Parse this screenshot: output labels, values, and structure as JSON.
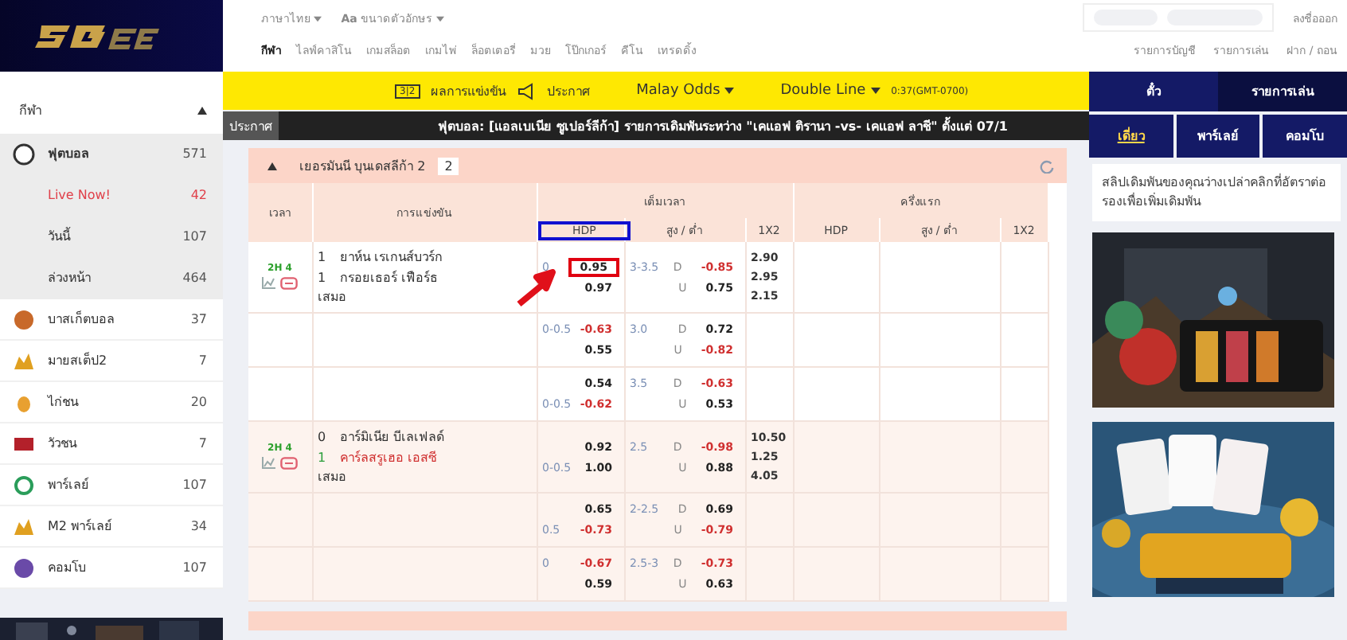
{
  "header": {
    "language": "ภาษาไทย",
    "font_size_icon": "Aa",
    "font_size": "ขนาดตัวอักษร",
    "logout": "ลงชื่อออก",
    "nav": [
      {
        "label": "กีฬา",
        "selected": true
      },
      {
        "label": "ไลฟ์คาสิโน",
        "selected": false
      },
      {
        "label": "เกมสล็อต",
        "selected": false
      },
      {
        "label": "เกมไพ่",
        "selected": false
      },
      {
        "label": "ล็อตเตอรี่",
        "selected": false
      },
      {
        "label": "มวย",
        "selected": false
      },
      {
        "label": "โป๊กเกอร์",
        "selected": false
      },
      {
        "label": "คีโน",
        "selected": false
      },
      {
        "label": "เทรดดิ้ง",
        "selected": false
      }
    ],
    "account_links": [
      "รายการบัญชี",
      "รายการเล่น",
      "ฝาก / ถอน"
    ]
  },
  "sidebar": {
    "title": "กีฬา",
    "items": [
      {
        "kind": "soccer",
        "label": "ฟุตบอล",
        "count": "571",
        "expanded": true,
        "children": [
          {
            "label": "Live Now!",
            "count": "42",
            "live": true
          },
          {
            "label": "วันนี้",
            "count": "107",
            "live": false
          },
          {
            "label": "ล่วงหน้า",
            "count": "464",
            "live": false
          }
        ]
      },
      {
        "kind": "basketball",
        "label": "บาสเก็ตบอล",
        "count": "37",
        "expanded": false
      },
      {
        "kind": "mixparlay",
        "label": "มายสเต็ป2",
        "count": "7",
        "expanded": false
      },
      {
        "kind": "cockfight",
        "label": "ไก่ชน",
        "count": "20",
        "expanded": false
      },
      {
        "kind": "bullfight",
        "label": "วัวชน",
        "count": "7",
        "expanded": false
      },
      {
        "kind": "parlay",
        "label": "พาร์เลย์",
        "count": "107",
        "expanded": false
      },
      {
        "kind": "mixparlay",
        "label": "M2 พาร์เลย์",
        "count": "34",
        "expanded": false
      },
      {
        "kind": "combo",
        "label": "คอมโบ",
        "count": "107",
        "expanded": false
      }
    ]
  },
  "toolbar": {
    "score_icon": "3|2",
    "results": "ผลการแข่งขัน",
    "announce": "ประกาศ",
    "odds_type": "Malay Odds",
    "line_type": "Double Line",
    "time": "0:37(GMT-0700)"
  },
  "announcement": {
    "label": "ประกาศ",
    "text": "ฟุตบอล: [แอลเบเนีย ซูเปอร์ลีก้า] รายการเดิมพันระหว่าง \"เคแอฟ ติรานา -vs- เคแอฟ ลาชี\" ตั้งแต่ 07/1"
  },
  "league": {
    "name": "เยอรมันนี บุนเดสลีก้า 2",
    "count": "2",
    "group_headers": [
      "เวลา",
      "การแข่งขัน",
      "เต็มเวลา",
      "ครึ่งแรก"
    ],
    "sub_headers": [
      {
        "label": "HDP",
        "highlighted": true
      },
      {
        "label": "สูง / ต่ำ",
        "highlighted": false
      },
      {
        "label": "1X2",
        "highlighted": false
      },
      {
        "label": "HDP",
        "highlighted": false
      },
      {
        "label": "สูง / ต่ำ",
        "highlighted": false
      },
      {
        "label": "1X2",
        "highlighted": false
      }
    ],
    "matches": [
      {
        "time": "2H 4",
        "teams": [
          {
            "score": "1",
            "name": "ยาห์น เรเกนส์บวร์ก",
            "favorite": false
          },
          {
            "score": "1",
            "name": "กรอยเธอร์ เฟือร์ธ",
            "favorite": false
          }
        ],
        "draw": "เสมอ",
        "x12": [
          "2.90",
          "2.95",
          "2.15"
        ],
        "lines": [
          {
            "hdp": [
              {
                "line": "0",
                "odds": "0.95",
                "negative": false,
                "highlighted": true
              },
              {
                "odds": "0.97",
                "negative": false,
                "highlighted": false
              }
            ],
            "ou_line": "3-3.5",
            "ou": [
              {
                "label": "D",
                "odds": "-0.85",
                "negative": true
              },
              {
                "label": "U",
                "odds": "0.75",
                "negative": false
              }
            ]
          },
          {
            "hdp": [
              {
                "line": "0-0.5",
                "odds": "-0.63",
                "negative": true,
                "highlighted": false
              },
              {
                "odds": "0.55",
                "negative": false,
                "highlighted": false
              }
            ],
            "ou_line": "3.0",
            "ou": [
              {
                "label": "D",
                "odds": "0.72",
                "negative": false
              },
              {
                "label": "U",
                "odds": "-0.82",
                "negative": true
              }
            ]
          },
          {
            "hdp": [
              {
                "odds": "0.54",
                "negative": false,
                "highlighted": false
              },
              {
                "line": "0-0.5",
                "odds": "-0.62",
                "negative": true,
                "highlighted": false
              }
            ],
            "ou_line": "3.5",
            "ou": [
              {
                "label": "D",
                "odds": "-0.63",
                "negative": true
              },
              {
                "label": "U",
                "odds": "0.53",
                "negative": false
              }
            ]
          }
        ]
      },
      {
        "time": "2H 4",
        "teams": [
          {
            "score": "0",
            "name": "อาร์มิเนีย บีเลเฟลด์",
            "favorite": false
          },
          {
            "score": "1",
            "name": "คาร์ลสรูเฮอ เอสซี",
            "favorite": true
          }
        ],
        "draw": "เสมอ",
        "x12": [
          "10.50",
          "1.25",
          "4.05"
        ],
        "lines": [
          {
            "hdp": [
              {
                "odds": "0.92",
                "negative": false,
                "highlighted": false
              },
              {
                "line": "0-0.5",
                "odds": "1.00",
                "negative": false,
                "highlighted": false
              }
            ],
            "ou_line": "2.5",
            "ou": [
              {
                "label": "D",
                "odds": "-0.98",
                "negative": true
              },
              {
                "label": "U",
                "odds": "0.88",
                "negative": false
              }
            ]
          },
          {
            "hdp": [
              {
                "odds": "0.65",
                "negative": false,
                "highlighted": false
              },
              {
                "line": "0.5",
                "odds": "-0.73",
                "negative": true,
                "highlighted": false
              }
            ],
            "ou_line": "2-2.5",
            "ou": [
              {
                "label": "D",
                "odds": "0.69",
                "negative": false
              },
              {
                "label": "U",
                "odds": "-0.79",
                "negative": true
              }
            ]
          },
          {
            "hdp": [
              {
                "line": "0",
                "odds": "-0.67",
                "negative": true,
                "highlighted": false
              },
              {
                "odds": "0.59",
                "negative": false,
                "highlighted": false
              }
            ],
            "ou_line": "2.5-3",
            "ou": [
              {
                "label": "D",
                "odds": "-0.73",
                "negative": true
              },
              {
                "label": "U",
                "odds": "0.63",
                "negative": false
              }
            ]
          }
        ]
      }
    ]
  },
  "betslip": {
    "tabs": [
      {
        "label": "ตั๋ว",
        "selected": true
      },
      {
        "label": "รายการเล่น",
        "selected": false
      }
    ],
    "modes": [
      {
        "label": "เดี่ยว",
        "selected": true
      },
      {
        "label": "พาร์เลย์",
        "selected": false
      },
      {
        "label": "คอมโบ",
        "selected": false
      }
    ],
    "empty_message": "สลิปเดิมพันของคุณว่างเปล่าคลิกที่อัตราต่อรองเพื่อเพิ่มเดิมพัน"
  }
}
